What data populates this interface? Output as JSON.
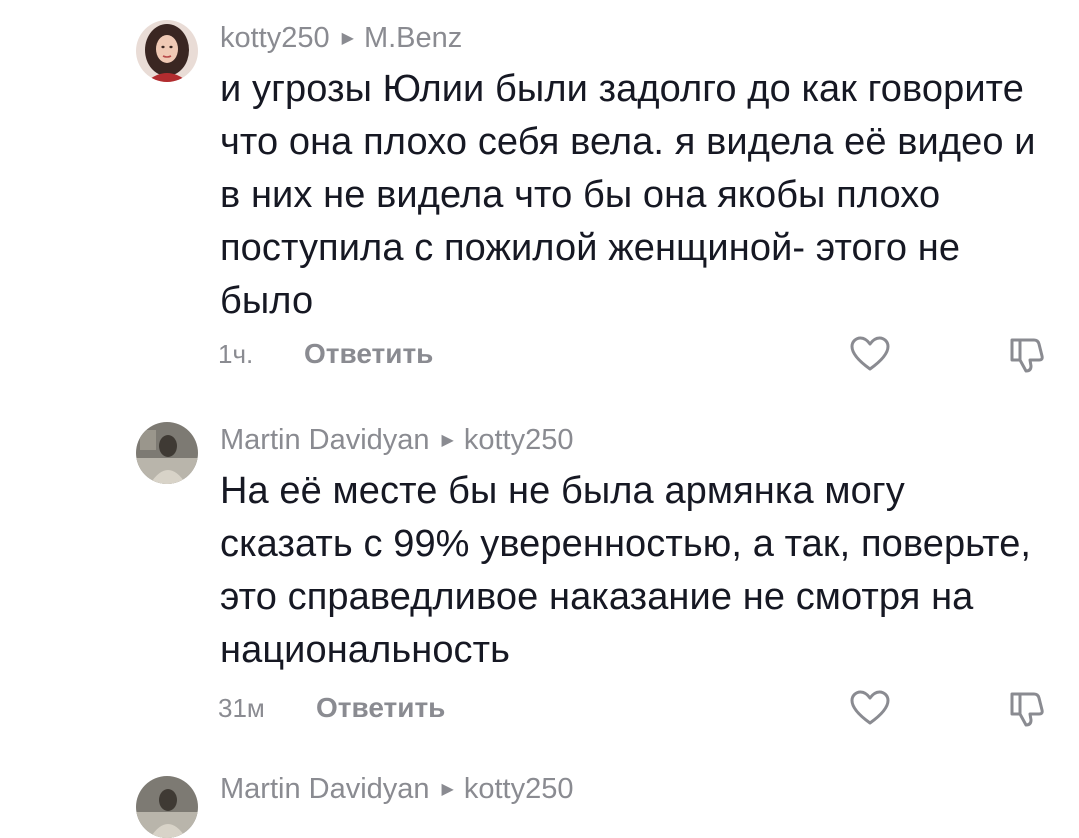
{
  "comments": [
    {
      "author": "kotty250",
      "reply_to": "M.Benz",
      "text": "и угрозы Юлии были задолго до как говорите что она плохо себя вела. я видела её видео и в них не видела что бы она якобы плохо поступила с пожилой женщиной- этого не было",
      "time": "1ч.",
      "reply_label": "Ответить",
      "like_icon": "heart-outline-icon",
      "dislike_icon": "thumbs-down-icon"
    },
    {
      "author": "Martin Davidyan",
      "reply_to": "kotty250",
      "text": "На её месте бы не была армянка могу сказать с 99% уверенностью, а так, поверьте, это справедливое наказание не смотря на национальность",
      "time": "31м",
      "reply_label": "Ответить",
      "like_icon": "heart-outline-icon",
      "dislike_icon": "thumbs-down-icon"
    },
    {
      "author": "Martin Davidyan",
      "reply_to": "kotty250"
    }
  ],
  "colors": {
    "text": "#161823",
    "muted": "#8a8b91",
    "background": "#ffffff"
  }
}
